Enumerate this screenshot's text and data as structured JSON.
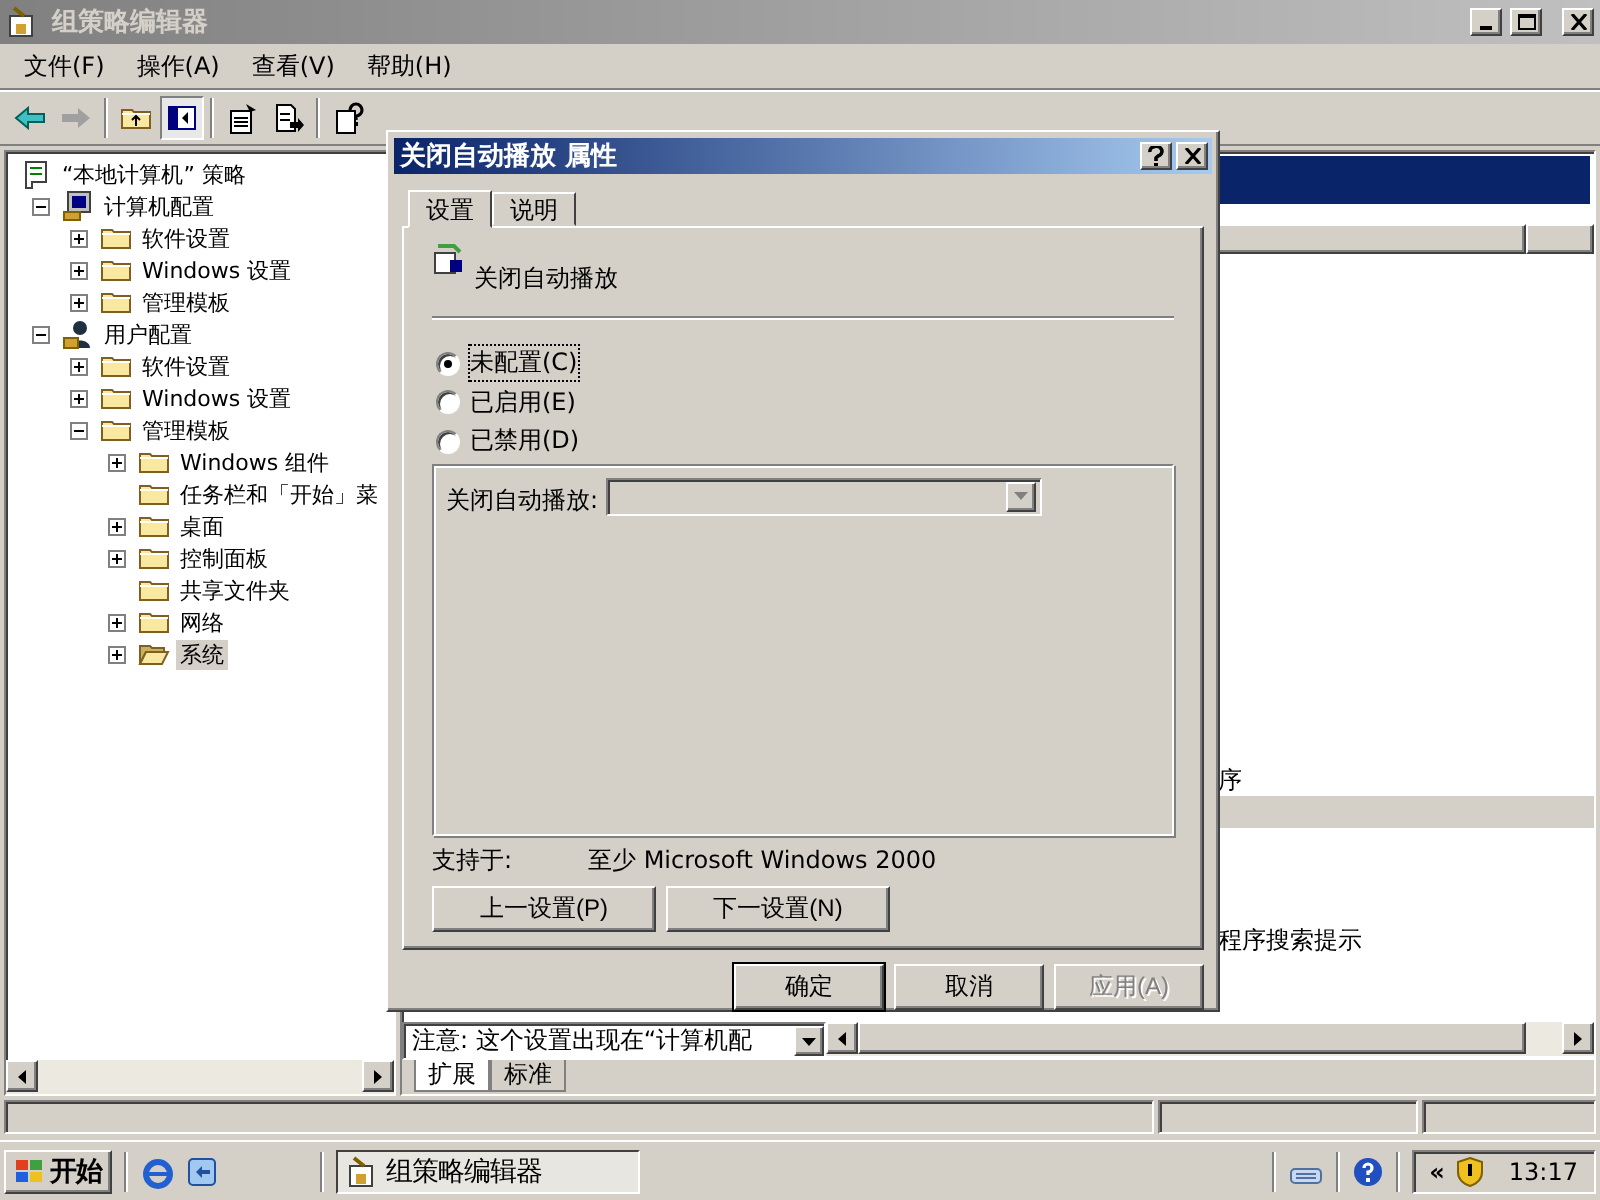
{
  "window": {
    "title": "组策略编辑器"
  },
  "menu": [
    "文件(F)",
    "操作(A)",
    "查看(V)",
    "帮助(H)"
  ],
  "tree": {
    "items": [
      {
        "label": "“本地计算机” 策略",
        "kind": "root",
        "selected": false,
        "children": [
          {
            "label": "计算机配置",
            "kind": "branch",
            "expanded": true,
            "selected": false,
            "children": [
              {
                "label": "软件设置",
                "kind": "branch",
                "expanded": false,
                "selected": false
              },
              {
                "label": "Windows 设置",
                "kind": "branch",
                "expanded": false,
                "selected": false
              },
              {
                "label": "管理模板",
                "kind": "branch",
                "expanded": false,
                "selected": false
              }
            ]
          },
          {
            "label": "用户配置",
            "kind": "branch",
            "expanded": true,
            "selected": false,
            "children": [
              {
                "label": "软件设置",
                "kind": "branch",
                "expanded": false,
                "selected": false
              },
              {
                "label": "Windows 设置",
                "kind": "branch",
                "expanded": false,
                "selected": false
              },
              {
                "label": "管理模板",
                "kind": "branch",
                "expanded": true,
                "selected": false,
                "children": [
                  {
                    "label": "Windows 组件",
                    "kind": "branch",
                    "expanded": false,
                    "selected": false
                  },
                  {
                    "label": "任务栏和「开始」菜",
                    "kind": "leaf",
                    "selected": false
                  },
                  {
                    "label": "桌面",
                    "kind": "branch",
                    "expanded": false,
                    "selected": false
                  },
                  {
                    "label": "控制面板",
                    "kind": "branch",
                    "expanded": false,
                    "selected": false
                  },
                  {
                    "label": "共享文件夹",
                    "kind": "leaf",
                    "selected": false
                  },
                  {
                    "label": "网络",
                    "kind": "branch",
                    "expanded": false,
                    "selected": false
                  },
                  {
                    "label": "系统",
                    "kind": "branch",
                    "expanded": false,
                    "selected": true
                  }
                ]
              }
            ]
          }
        ]
      }
    ]
  },
  "right_pane": {
    "rows": [
      {
        "name": "序",
        "selected": false
      },
      {
        "selected": true
      },
      {
        "selected": false
      },
      {
        "selected": false
      },
      {
        "selected": false
      },
      {
        "name": "程序搜索提示",
        "selected": false
      }
    ],
    "description": "注意: 这个设置出现在“计算机配",
    "view_tabs": [
      {
        "label": "扩展",
        "selected": true
      },
      {
        "label": "标准",
        "selected": false
      }
    ]
  },
  "dialog": {
    "title": "关闭自动播放 属性",
    "tabs": [
      {
        "label": "设置",
        "selected": true
      },
      {
        "label": "说明",
        "selected": false
      }
    ],
    "setting_name": "关闭自动播放",
    "options": [
      {
        "label": "未配置(C)",
        "selected": true
      },
      {
        "label": "已启用(E)",
        "selected": false
      },
      {
        "label": "已禁用(D)",
        "selected": false
      }
    ],
    "option_field": {
      "label": "关闭自动播放:",
      "disabled": true
    },
    "supported_label": "支持于:",
    "supported_value": "至少 Microsoft Windows 2000",
    "nav_buttons": [
      "上一设置(P)",
      "下一设置(N)"
    ],
    "buttons": [
      {
        "label": "确定",
        "default": true,
        "disabled": false
      },
      {
        "label": "取消",
        "default": false,
        "disabled": false
      },
      {
        "label": "应用(A)",
        "default": false,
        "disabled": true
      }
    ]
  },
  "taskbar": {
    "start": "开始",
    "tasks": [
      {
        "label": "组策略编辑器",
        "selected": true
      }
    ],
    "tray_toggle": "«",
    "clock": "13:17"
  }
}
